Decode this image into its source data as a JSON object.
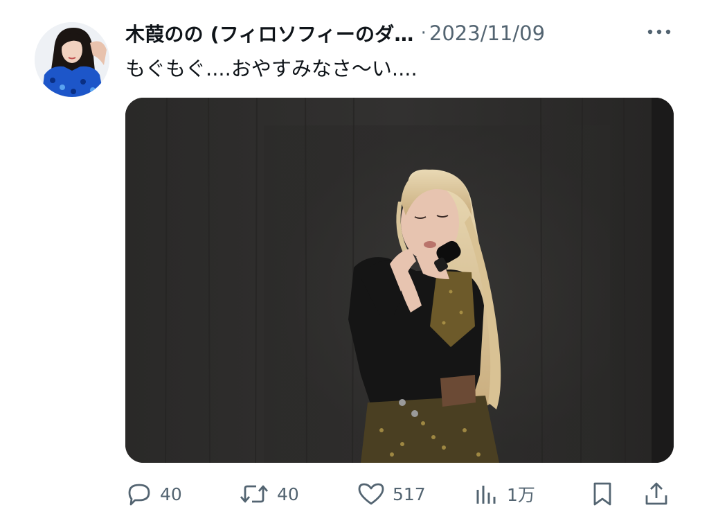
{
  "tweet": {
    "display_name": "木葭のの (フィロソフィーのダ…",
    "separator": "·",
    "timestamp": "2023/11/09",
    "text": "もぐもぐ....おやすみなさ〜い....",
    "more_icon": "more-horizontal-icon"
  },
  "actions": {
    "reply": {
      "icon": "reply-icon",
      "count": "40"
    },
    "retweet": {
      "icon": "retweet-icon",
      "count": "40"
    },
    "like": {
      "icon": "heart-icon",
      "count": "517"
    },
    "views": {
      "icon": "views-chart-icon",
      "count": "1万"
    },
    "bookmark": {
      "icon": "bookmark-icon"
    },
    "share": {
      "icon": "share-icon"
    }
  },
  "colors": {
    "text_primary": "#0f1419",
    "text_secondary": "#536471",
    "background": "#ffffff"
  }
}
